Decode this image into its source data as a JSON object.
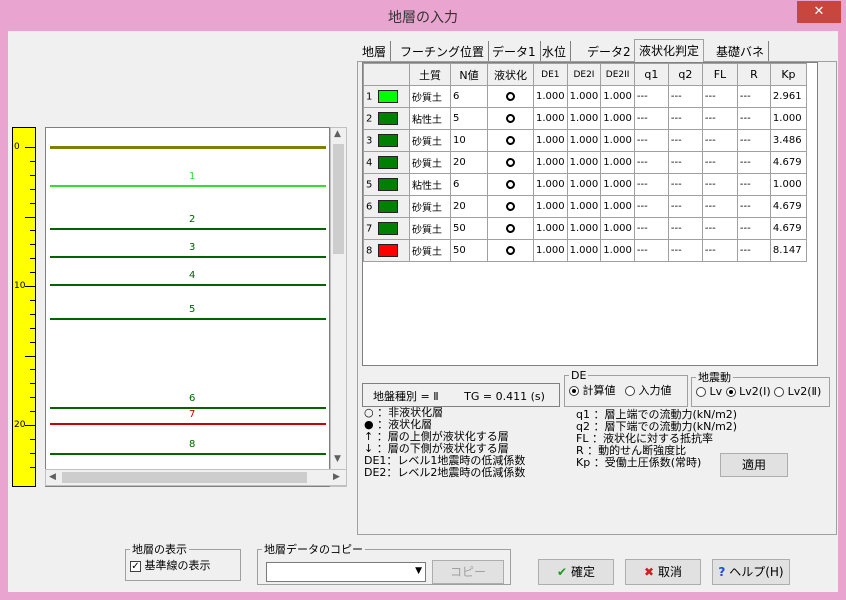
{
  "window": {
    "title": "地層の入力",
    "close_glyph": "✕"
  },
  "ruler": {
    "labels": [
      "0",
      "10",
      "20"
    ],
    "color": "#ffff00"
  },
  "strata": {
    "labels": [
      "1",
      "2",
      "3",
      "4",
      "5",
      "6",
      "7",
      "8"
    ],
    "colors": {
      "base": "#808000",
      "light": "#33dd33",
      "dark": "#006400",
      "red": "#cc0000"
    }
  },
  "tabs": [
    "地層",
    "フーチング位置",
    "データ1",
    "水位",
    "データ2",
    "液状化判定",
    "基礎バネ"
  ],
  "grid": {
    "headers": [
      "",
      "土質",
      "N値",
      "液状化",
      "DE1",
      "DE2I",
      "DE2II",
      "q1",
      "q2",
      "FL",
      "R",
      "Kp"
    ],
    "rows": [
      {
        "no": "1",
        "color": "#00ff00",
        "soil": "砂質土",
        "n": "6",
        "de1": "1.000",
        "de2i": "1.000",
        "de2ii": "1.000",
        "q1": "---",
        "q2": "---",
        "fl": "---",
        "r": "---",
        "kp": "2.961"
      },
      {
        "no": "2",
        "color": "#008000",
        "soil": "粘性土",
        "n": "5",
        "de1": "1.000",
        "de2i": "1.000",
        "de2ii": "1.000",
        "q1": "---",
        "q2": "---",
        "fl": "---",
        "r": "---",
        "kp": "1.000"
      },
      {
        "no": "3",
        "color": "#008000",
        "soil": "砂質土",
        "n": "10",
        "de1": "1.000",
        "de2i": "1.000",
        "de2ii": "1.000",
        "q1": "---",
        "q2": "---",
        "fl": "---",
        "r": "---",
        "kp": "3.486"
      },
      {
        "no": "4",
        "color": "#008000",
        "soil": "砂質土",
        "n": "20",
        "de1": "1.000",
        "de2i": "1.000",
        "de2ii": "1.000",
        "q1": "---",
        "q2": "---",
        "fl": "---",
        "r": "---",
        "kp": "4.679"
      },
      {
        "no": "5",
        "color": "#008000",
        "soil": "粘性土",
        "n": "6",
        "de1": "1.000",
        "de2i": "1.000",
        "de2ii": "1.000",
        "q1": "---",
        "q2": "---",
        "fl": "---",
        "r": "---",
        "kp": "1.000"
      },
      {
        "no": "6",
        "color": "#008000",
        "soil": "砂質土",
        "n": "20",
        "de1": "1.000",
        "de2i": "1.000",
        "de2ii": "1.000",
        "q1": "---",
        "q2": "---",
        "fl": "---",
        "r": "---",
        "kp": "4.679"
      },
      {
        "no": "7",
        "color": "#008000",
        "soil": "砂質土",
        "n": "50",
        "de1": "1.000",
        "de2i": "1.000",
        "de2ii": "1.000",
        "q1": "---",
        "q2": "---",
        "fl": "---",
        "r": "---",
        "kp": "4.679"
      },
      {
        "no": "8",
        "color": "#ff0000",
        "soil": "砂質土",
        "n": "50",
        "de1": "1.000",
        "de2i": "1.000",
        "de2ii": "1.000",
        "q1": "---",
        "q2": "---",
        "fl": "---",
        "r": "---",
        "kp": "8.147"
      }
    ]
  },
  "ground": {
    "type_text": "地盤種別 = Ⅱ",
    "tg_text": "TG = 0.411 (s)"
  },
  "de_group": {
    "label": "DE",
    "opt_calc": "計算値",
    "opt_input": "入力値"
  },
  "quake_group": {
    "label": "地震動",
    "opt_lv1": "Lv",
    "opt_lv2_1": "Lv2(Ⅰ)",
    "opt_lv2_2": "Lv2(Ⅱ)"
  },
  "legend_left": [
    "○ ：非液状化層",
    "● ：液状化層",
    "↑ ：層の上側が液状化する層",
    "↓ ：層の下側が液状化する層",
    "DE1：レベル1地震時の低減係数",
    "DE2：レベル2地震時の低減係数"
  ],
  "legend_right": [
    "q1 ：層上端での流動力(kN/m2)",
    "q2 ：層下端での流動力(kN/m2)",
    "FL ：液状化に対する抵抗率",
    "R  ：動的せん断強度比",
    "Kp ：受働土圧係数(常時)"
  ],
  "apply_label": "適用",
  "display_group": {
    "label": "地層の表示",
    "checkbox_label": "基準線の表示",
    "check_glyph": "✓"
  },
  "copy_group": {
    "label": "地層データのコピー",
    "select_value": "",
    "button_label": "コピー"
  },
  "footer": {
    "ok_label": "確定",
    "cancel_label": "取消",
    "help_label": "ヘルプ(H)"
  }
}
